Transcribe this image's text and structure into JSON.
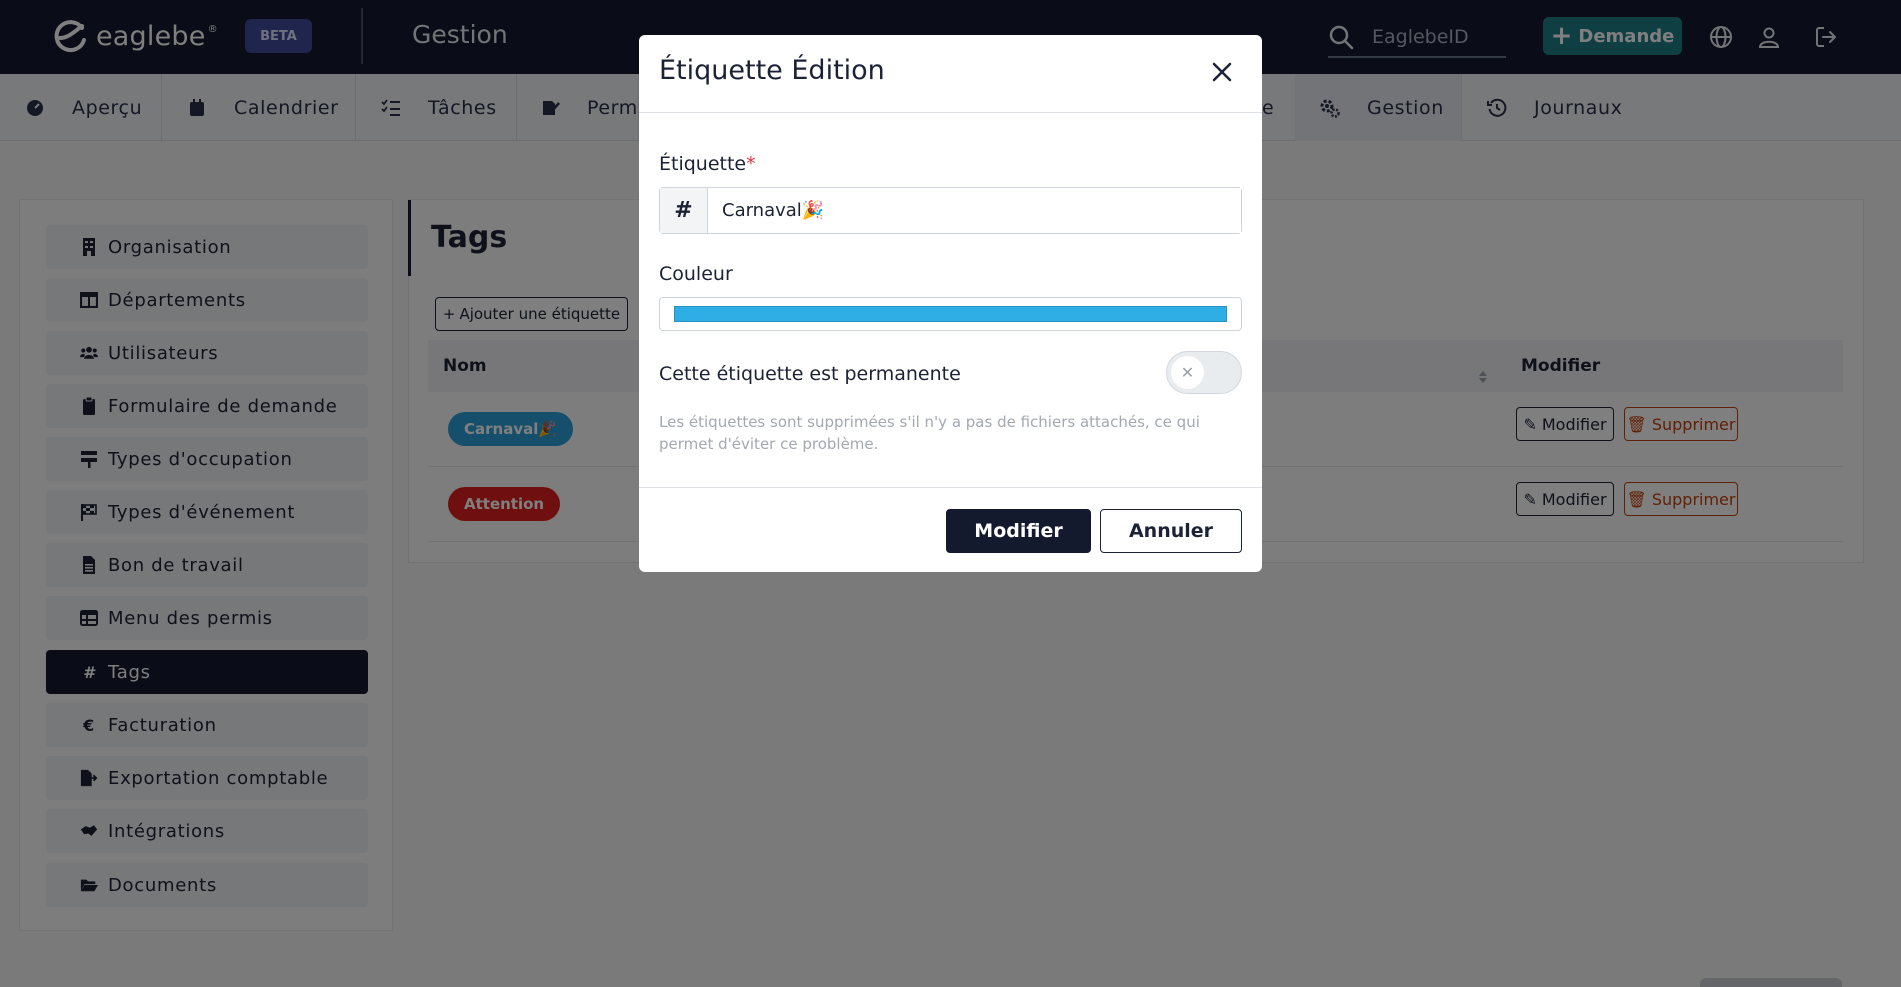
{
  "app": {
    "logo_text": "eaglebe",
    "beta_badge": "BETA",
    "section_title": "Gestion",
    "search": {
      "placeholder": "EaglebeID",
      "value": ""
    },
    "demande_button": "Demande"
  },
  "nav": {
    "tabs": [
      {
        "label": "Aperçu",
        "icon": "gauge-icon"
      },
      {
        "label": "Calendrier",
        "icon": "calendar-icon"
      },
      {
        "label": "Tâches",
        "icon": "checklist-icon"
      },
      {
        "label": "Permi",
        "icon": "signature-icon"
      },
      {
        "label": "e",
        "icon": ""
      },
      {
        "label": "Gestion",
        "icon": "cogs-icon",
        "active": true
      },
      {
        "label": "Journaux",
        "icon": "history-icon"
      }
    ]
  },
  "sidebar": {
    "items": [
      {
        "label": "Organisation",
        "icon": "building-icon"
      },
      {
        "label": "Départements",
        "icon": "columns-icon"
      },
      {
        "label": "Utilisateurs",
        "icon": "users-icon"
      },
      {
        "label": "Formulaire de demande",
        "icon": "clipboard-icon"
      },
      {
        "label": "Types d'occupation",
        "icon": "road-sign-icon"
      },
      {
        "label": "Types d'événement",
        "icon": "flag-checkered-icon"
      },
      {
        "label": "Bon de travail",
        "icon": "file-icon"
      },
      {
        "label": "Menu des permis",
        "icon": "table-icon"
      },
      {
        "label": "Tags",
        "icon": "hashtag-icon",
        "active": true
      },
      {
        "label": "Facturation",
        "icon": "euro-icon"
      },
      {
        "label": "Exportation comptable",
        "icon": "file-export-icon"
      },
      {
        "label": "Intégrations",
        "icon": "handshake-icon"
      },
      {
        "label": "Documents",
        "icon": "folder-open-icon"
      }
    ]
  },
  "main": {
    "title": "Tags",
    "add_button": "Ajouter une étiquette",
    "columns": {
      "name": "Nom",
      "modify": "Modifier"
    },
    "rows": [
      {
        "tag": "Carnaval🎉",
        "color": "#2b9fd6",
        "modify": "Modifier",
        "delete": "Supprimer"
      },
      {
        "tag": "Attention",
        "color": "#e01e1e",
        "modify": "Modifier",
        "delete": "Supprimer"
      }
    ]
  },
  "modal": {
    "title": "Étiquette Édition",
    "tag_label": "Étiquette",
    "required_mark": "*",
    "tag_prefix": "#",
    "tag_value": "Carnaval🎉",
    "color_label": "Couleur",
    "color_value": "#2faee5",
    "permanent_label": "Cette étiquette est permanente",
    "permanent": false,
    "help_text": "Les étiquettes sont supprimées s'il n'y a pas de fichiers attachés, ce qui permet d'éviter ce problème.",
    "submit_button": "Modifier",
    "cancel_button": "Annuler"
  }
}
